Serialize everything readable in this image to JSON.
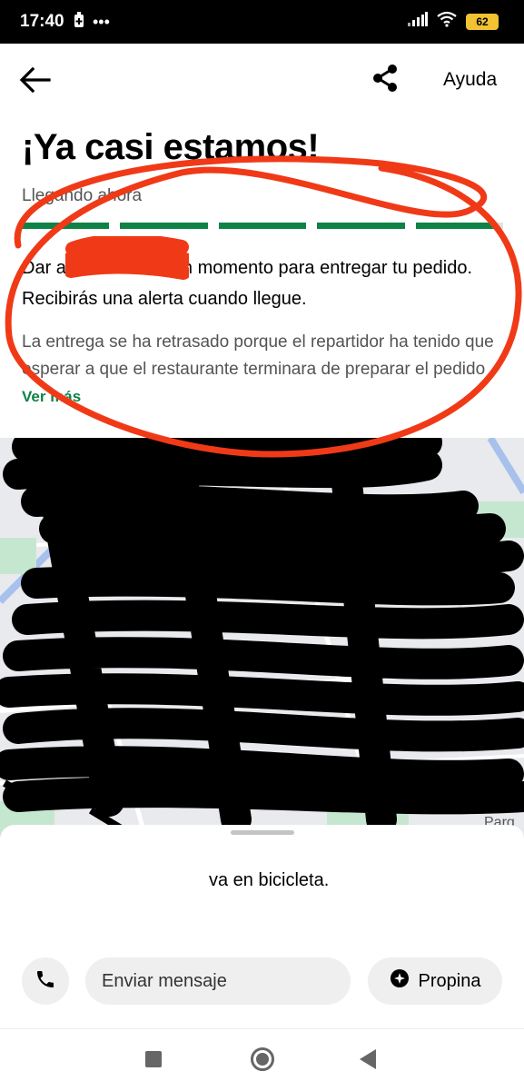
{
  "status_bar": {
    "time": "17:40",
    "battery": "62"
  },
  "header": {
    "help_label": "Ayuda"
  },
  "order_status": {
    "title": "¡Ya casi estamos!",
    "subtitle": "Llegando ahora",
    "progress_steps": 5,
    "progress_fraction": 0.98,
    "main_text": "Dar a… un momento para entregar tu pedido. Recibirás una alerta cuando llegue.",
    "main_text_prefix": "Dar a",
    "main_text_suffix": "n momento para entregar tu pedido. Recibirás una alerta cuando llegue.",
    "delay_text": "La entrega se ha retrasado porque el repartidor ha tenido que esperar a que el restaurante terminara de preparar el pedido",
    "see_more_label": "Ver más"
  },
  "map": {
    "label_visible": "Parq"
  },
  "courier": {
    "text": "va en bicicleta."
  },
  "actions": {
    "message_label": "Enviar mensaje",
    "tip_label": "Propina"
  },
  "icons": {
    "back": "arrow-left-icon",
    "share": "share-icon",
    "phone": "phone-icon",
    "tip": "sparkle-icon"
  },
  "colors": {
    "accent": "#0e8345",
    "redaction_red": "#f03a17"
  }
}
